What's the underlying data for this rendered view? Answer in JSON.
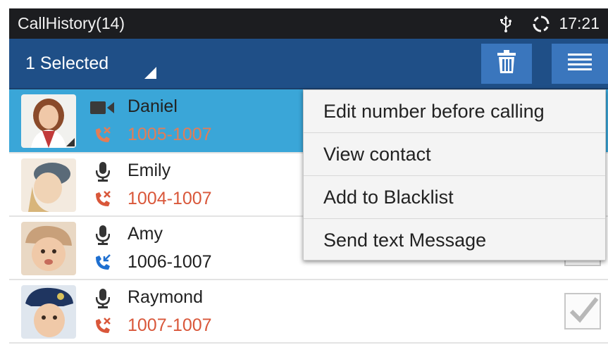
{
  "status_bar": {
    "title": "CallHistory(14)",
    "time": "17:21",
    "icons": [
      "usb-icon",
      "sync-icon"
    ]
  },
  "action_bar": {
    "selected_label": "1 Selected",
    "buttons": [
      "trash-icon",
      "menu-icon"
    ]
  },
  "calls": [
    {
      "name": "Daniel",
      "number": "1005-1007",
      "call_type": "video",
      "direction": "missed",
      "selected": true
    },
    {
      "name": "Emily",
      "number": "1004-1007",
      "call_type": "audio",
      "direction": "missed",
      "selected": false
    },
    {
      "name": "Amy",
      "number": "1006-1007",
      "call_type": "audio",
      "direction": "incoming",
      "selected": false
    },
    {
      "name": "Raymond",
      "number": "1007-1007",
      "call_type": "audio",
      "direction": "missed",
      "selected": false
    }
  ],
  "popup_menu": {
    "items": [
      "Edit number before calling",
      "View contact",
      "Add to Blacklist",
      "Send text Message"
    ]
  },
  "colors": {
    "status_bar_bg": "#1c1d20",
    "action_bar_bg": "#1f4f87",
    "button_bg": "#3a76bd",
    "selected_row_bg": "#3aa6d8",
    "missed_number": "#d9573a",
    "incoming_arrow": "#1e6fd0"
  }
}
